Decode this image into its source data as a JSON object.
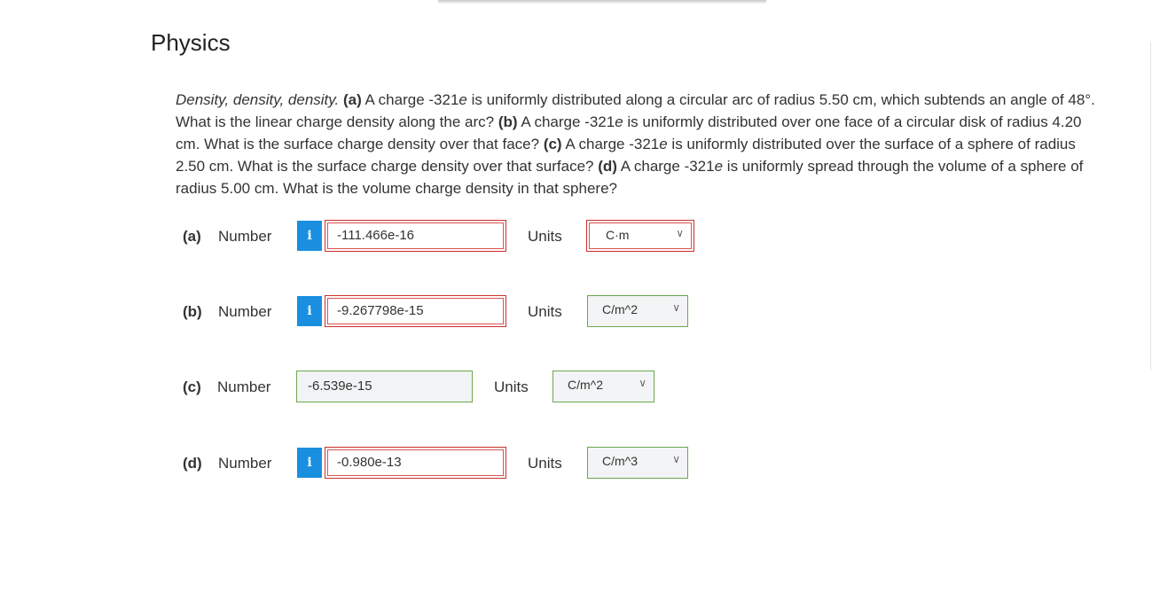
{
  "page": {
    "title": "Physics"
  },
  "question": {
    "lead": "Density, density, density.",
    "a_label": "(a)",
    "a_text": " A charge -321",
    "e": "e",
    "a_rest": " is uniformly distributed along a circular arc of radius 5.50 cm, which subtends an angle of 48°. What is the linear charge density along the arc? ",
    "b_label": "(b)",
    "b_text": " A charge -321",
    "b_rest": " is uniformly distributed over one face of a circular disk of radius 4.20 cm. What is the surface charge density over that face? ",
    "c_label": "(c)",
    "c_text": " A charge -321",
    "c_rest": " is uniformly distributed over the surface of a sphere of radius 2.50 cm. What is the surface charge density over that surface? ",
    "d_label": "(d)",
    "d_text": " A charge -321",
    "d_rest": " is uniformly spread through the volume of a sphere of radius 5.00 cm. What is the volume charge density in that sphere?"
  },
  "answers": [
    {
      "part": "(a)",
      "number_label": "Number",
      "info_icon": "i",
      "value": "-111.466e-16",
      "units_label": "Units",
      "unit": "C·m",
      "status": "incorrect"
    },
    {
      "part": "(b)",
      "number_label": "Number",
      "info_icon": "i",
      "value": "-9.267798e-15",
      "units_label": "Units",
      "unit": "C/m^2",
      "status": "incorrect"
    },
    {
      "part": "(c)",
      "number_label": "Number",
      "value": "-6.539e-15",
      "units_label": "Units",
      "unit": "C/m^2",
      "status": "correct"
    },
    {
      "part": "(d)",
      "number_label": "Number",
      "info_icon": "i",
      "value": "-0.980e-13",
      "units_label": "Units",
      "unit": "C/m^3",
      "status": "incorrect"
    }
  ],
  "icons": {
    "chevron": "chevron-down-icon",
    "info": "info-icon"
  },
  "colors": {
    "error": "#c9302c",
    "correct": "#6aa84f",
    "info": "#1a8fe0"
  }
}
